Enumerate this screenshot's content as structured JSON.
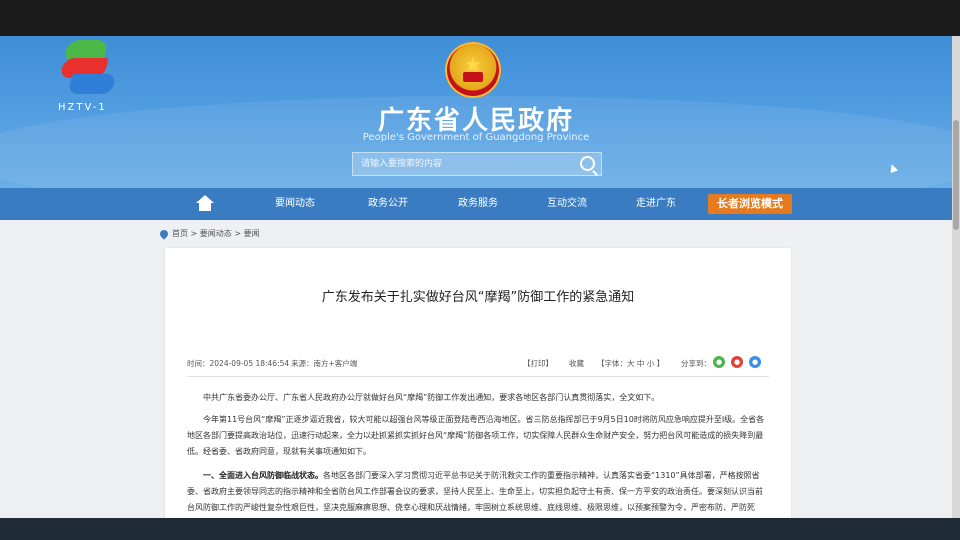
{
  "watermark": {
    "channel": "HZTV-1"
  },
  "site": {
    "title": "广东省人民政府",
    "subtitle": "People's Government of Guangdong Province",
    "search_placeholder": "请输入要搜索的内容"
  },
  "nav": {
    "items": [
      "要闻动态",
      "政务公开",
      "政务服务",
      "互动交流",
      "走进广东"
    ],
    "elder_mode": "长者浏览模式"
  },
  "breadcrumb": "首页 > 要闻动态 > 要闻",
  "article": {
    "title": "广东发布关于扎实做好台风“摩羯”防御工作的紧急通知",
    "time": "时间：2024-09-05 18:46:54",
    "source": "来源：南方+客户端",
    "print": "【打印】",
    "favorite": "收藏",
    "font_size": "【字体：大  中  小 】",
    "share_label": "分享到：",
    "paragraphs": [
      "中共广东省委办公厅、广东省人民政府办公厅就做好台风“摩羯”防御工作发出通知，要求各地区各部门认真贯彻落实，全文如下。",
      "今年第11号台风“摩羯”正逐步逼近我省，较大可能以超强台风等级正面登陆粤西沿海地区。省三防总指挥部已于9月5日10时将防风应急响应提升至Ⅰ级。全省各地区各部门要提高政治站位，迅速行动起来，全力以赴抓紧抓实抓好台风“摩羯”防御各项工作，切实保障人民群众生命财产安全，努力把台风可能造成的损失降到最低。经省委、省政府同意，现就有关事项通知如下。",
      "一、全面进入台风防御临战状态。各地区各部门要深入学习贯彻习近平总书记关于防汛救灾工作的重要指示精神，认真落实省委“1310”具体部署，严格按照省委、省政府主要领导同志的指示精神和全省防台风工作部署会议的要求，坚持人民至上、生命至上，切实担负起守土有责、保一方平安的政治责任。要深刻认识当前台风防御工作的严峻性复杂性艰巨性，坚决克服麻痹思想、侥幸心理和厌战情绪，牢固树立系统思维、底线思维、极限思维，以预案预警为令，严密布防、严防死守，做到宁可信其有、不可信其无，宁可十防九空、不可失防万一，宁可备而不用、不可用时无备，立足超强台风正面登陆最不利情况，扎实做好台风防御各项工作，全力以赴保障人民群众生命财产安全。"
    ],
    "lead_bold": "一、全面进入台风防御临战状态。"
  },
  "colors": {
    "banner": "#4f9be0",
    "nav": "#3a7cc2",
    "elder_button": "#e67a1e"
  }
}
